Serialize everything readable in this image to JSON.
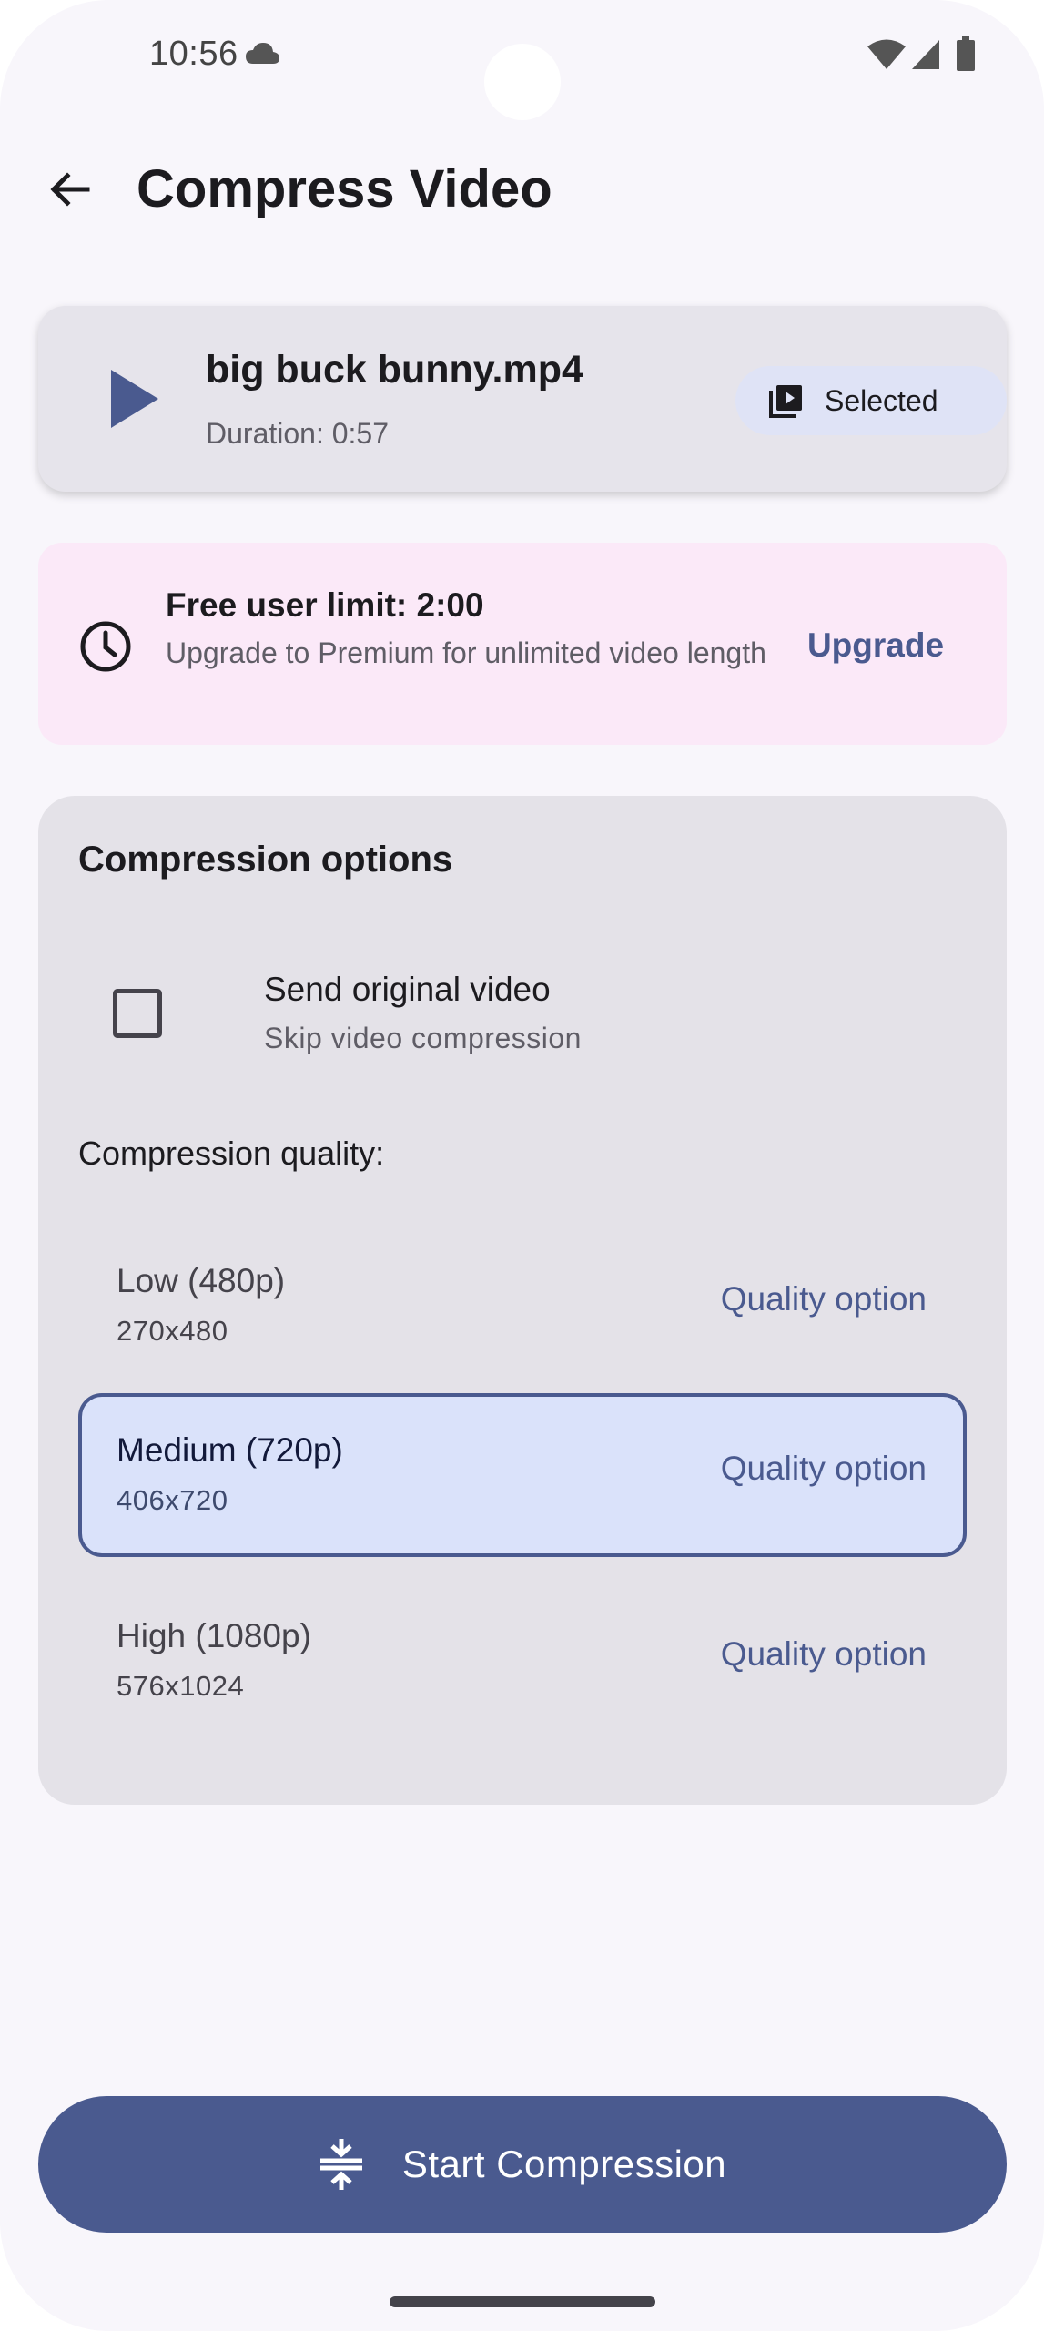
{
  "status_bar": {
    "time": "10:56",
    "icons": [
      "cloud-icon",
      "wifi-icon",
      "signal-icon",
      "battery-icon"
    ]
  },
  "top_bar": {
    "back_icon": "arrow-back-icon",
    "title": "Compress Video"
  },
  "file_card": {
    "play_icon": "play-icon",
    "file_name": "big buck bunny.mp4",
    "duration": "Duration: 0:57",
    "chip_icon": "video-library-icon",
    "chip_label": "Selected"
  },
  "limit_banner": {
    "icon": "clock-icon",
    "title": "Free user limit: 2:00",
    "description": "Upgrade to Premium for unlimited video length",
    "action_label": "Upgrade"
  },
  "options": {
    "section_title": "Compression options",
    "send_original": {
      "title": "Send original video",
      "subtitle": "Skip video compression",
      "checked": false
    },
    "quality_label": "Compression quality:",
    "qualities": [
      {
        "name": "Low (480p)",
        "resolution": "270x480",
        "action": "Quality option",
        "selected": false
      },
      {
        "name": "Medium (720p)",
        "resolution": "406x720",
        "action": "Quality option",
        "selected": true
      },
      {
        "name": "High (1080p)",
        "resolution": "576x1024",
        "action": "Quality option",
        "selected": false
      }
    ]
  },
  "start_button": {
    "icon": "compress-icon",
    "label": "Start Compression"
  },
  "colors": {
    "primary": "#4a5a8f",
    "background": "#f8f6fb",
    "card": "#e4e2e8",
    "banner": "#fbe9f8",
    "selected_fill": "#dae2fa"
  }
}
